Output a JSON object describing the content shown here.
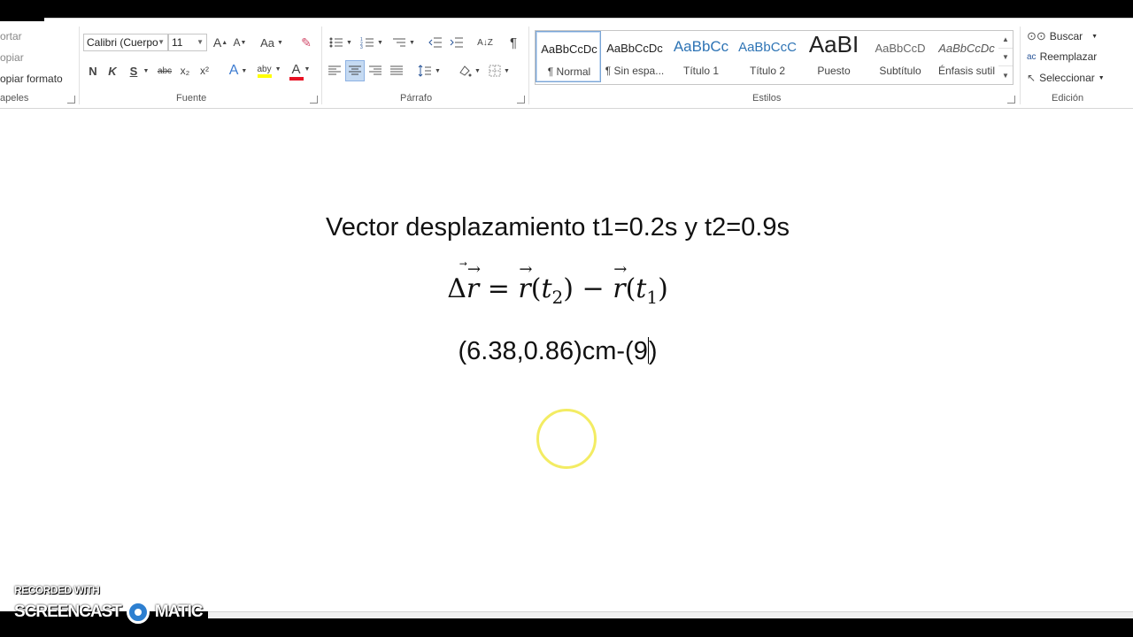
{
  "clipboard": {
    "cut": "ortar",
    "copy": "opiar",
    "format_painter": "opiar formato",
    "group_label": "apeles"
  },
  "font": {
    "family": "Calibri (Cuerpo",
    "size": "11",
    "grow": "A",
    "shrink": "A",
    "change_case": "Aa",
    "bold": "N",
    "italic": "K",
    "underline": "S",
    "strikethrough": "abc",
    "subscript": "x₂",
    "superscript": "x²",
    "highlight": "aby",
    "font_color": "A",
    "group_label": "Fuente"
  },
  "paragraph": {
    "group_label": "Párrafo",
    "show_marks": "¶"
  },
  "styles": {
    "group_label": "Estilos",
    "items": [
      {
        "sample": "AaBbCcDc",
        "name": "¶ Normal"
      },
      {
        "sample": "AaBbCcDc",
        "name": "¶ Sin espa..."
      },
      {
        "sample": "AaBbCc",
        "name": "Título 1"
      },
      {
        "sample": "AaBbCcC",
        "name": "Título 2"
      },
      {
        "sample": "AaBI",
        "name": "Puesto"
      },
      {
        "sample": "AaBbCcD",
        "name": "Subtítulo"
      },
      {
        "sample": "AaBbCcDc",
        "name": "Énfasis sutil"
      }
    ]
  },
  "editing": {
    "find": "Buscar",
    "replace": "Reemplazar",
    "select": "Seleccionar",
    "group_label": "Edición"
  },
  "document": {
    "title_line": "Vector desplazamiento t1=0.2s y t2=0.9s",
    "eq_delta": "Δ",
    "eq_r": "r",
    "eq_equals": " = ",
    "eq_t": "t",
    "eq_sub2": "2",
    "eq_minus": " − ",
    "eq_sub1": "1",
    "value_line_before": "(6.38,0.86)cm-(9",
    "value_line_after": ")"
  },
  "watermark": {
    "top": "RECORDED WITH",
    "left": "SCREENCAST",
    "right": "MATIC"
  },
  "colors": {
    "accent": "#2b579a",
    "cursor_ring": "#f3ec63",
    "highlight": "#ffff00",
    "font_color_bar": "#e81123"
  }
}
